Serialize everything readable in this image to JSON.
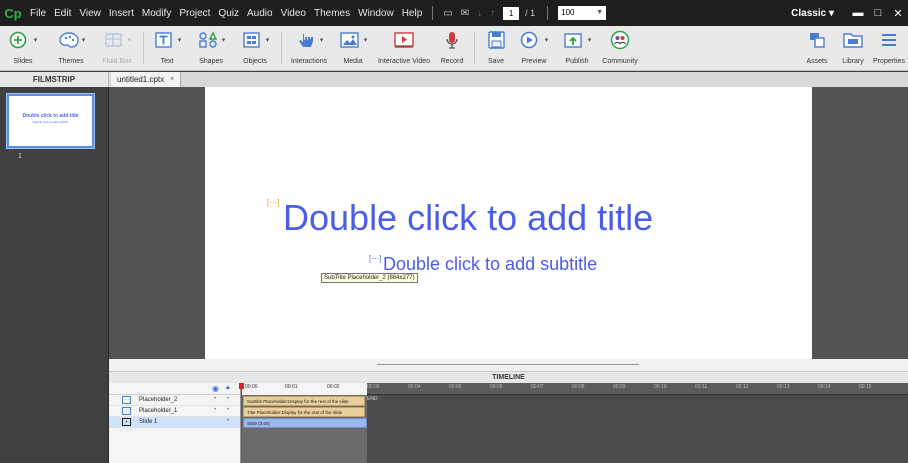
{
  "app": {
    "logo": "Cp",
    "workspace": "Classic"
  },
  "menu": [
    "File",
    "Edit",
    "View",
    "Insert",
    "Modify",
    "Project",
    "Quiz",
    "Audio",
    "Video",
    "Themes",
    "Window",
    "Help"
  ],
  "menubar": {
    "page_current": "1",
    "page_total": "/ 1",
    "zoom": "100",
    "workspace_caret": "▾"
  },
  "window_controls": {
    "minimize": "▬",
    "maximize": "□",
    "close": "✕"
  },
  "toolbar": {
    "slides": "Slides",
    "themes": "Themes",
    "fluid_box": "Fluid Box",
    "text": "Text",
    "shapes": "Shapes",
    "objects": "Objects",
    "interactions": "Interactions",
    "media": "Media",
    "interactive_video": "Interactive Video",
    "record": "Record",
    "save": "Save",
    "preview": "Preview",
    "publish": "Publish",
    "community": "Community",
    "assets": "Assets",
    "library": "Library",
    "properties": "Properties"
  },
  "filmstrip": {
    "header": "FILMSTRIP",
    "slides": [
      {
        "number": "1",
        "title": "Double click to add title",
        "subtitle": "Double click to add subtitle"
      }
    ]
  },
  "tab": {
    "name": "untitled1.cptx",
    "close": "×"
  },
  "slide": {
    "title": "Double click to add title",
    "subtitle": "Double click to add subtitle",
    "tooltip": "SubTitle Placeholder_2 (864x277)"
  },
  "timeline": {
    "header": "TIMELINE",
    "layers": [
      {
        "name": "Placeholder_2",
        "icon": "placeholder-icon",
        "bar": "Subtitle Placeholder:Display for the rest of the slide"
      },
      {
        "name": "Placeholder_1",
        "icon": "placeholder-icon",
        "bar": "Title Placeholder:Display for the rest of the slide"
      },
      {
        "name": "Slide 1",
        "icon": "slide-icon",
        "bar": "Slide (3.0s)"
      }
    ],
    "ticks": [
      "00:00",
      "00:01",
      "00:02",
      "00:03",
      "00:04",
      "00:05",
      "00:06",
      "00:07",
      "00:08",
      "00:09",
      "00:10",
      "00:11",
      "00:12",
      "00:13",
      "00:14",
      "00:15"
    ],
    "end_label": "END"
  },
  "colors": {
    "accent": "#4a5de8",
    "logo": "#2fb14a",
    "playhead": "#e02020"
  }
}
